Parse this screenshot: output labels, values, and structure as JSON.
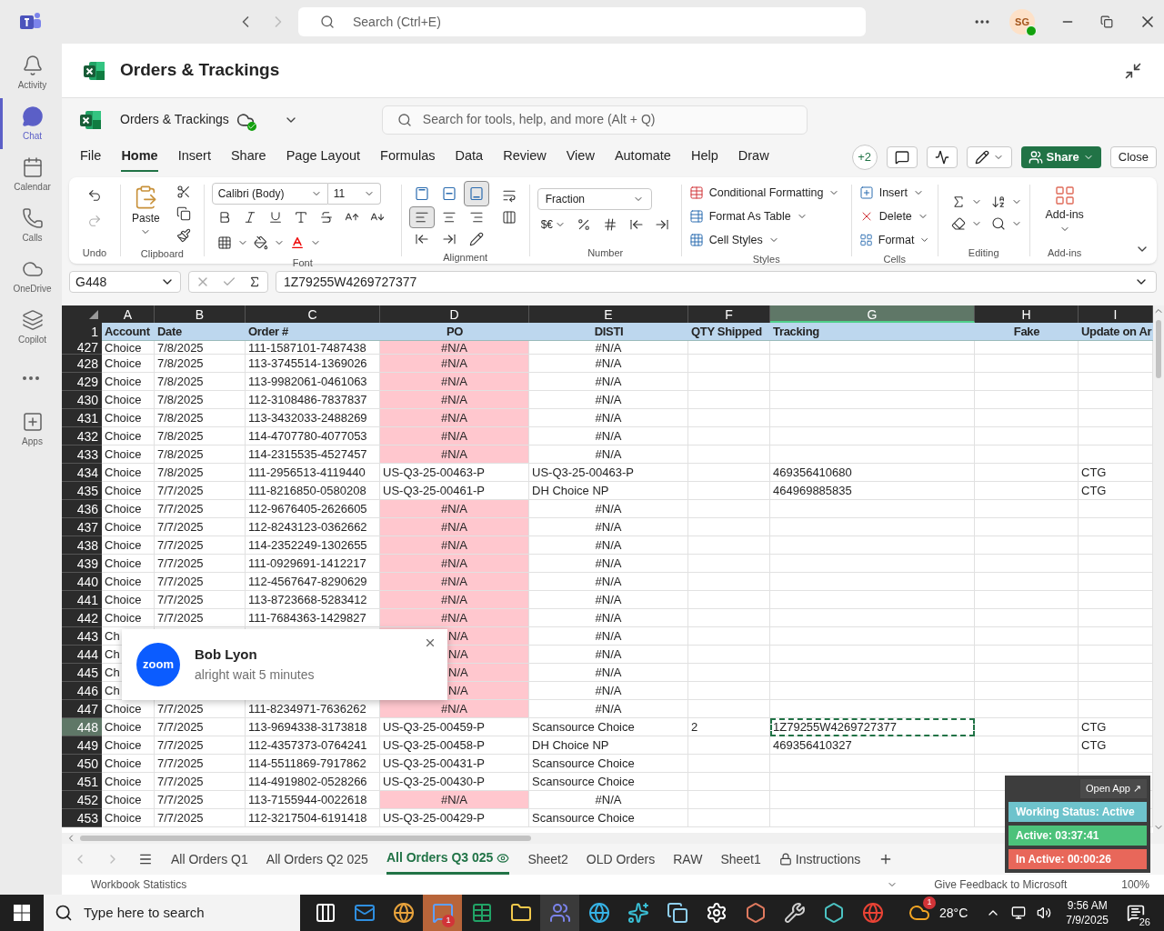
{
  "teams_bar": {
    "search_placeholder": "Search (Ctrl+E)",
    "avatar": "SG"
  },
  "rail": [
    {
      "label": "Activity",
      "selected": false
    },
    {
      "label": "Chat",
      "selected": true
    },
    {
      "label": "Calendar",
      "selected": false
    },
    {
      "label": "Calls",
      "selected": false
    },
    {
      "label": "OneDrive",
      "selected": false
    },
    {
      "label": "Copilot",
      "selected": false
    },
    {
      "label": "Apps",
      "selected": false
    }
  ],
  "app_header": {
    "title": "Orders & Trackings"
  },
  "excel_header": {
    "file_name": "Orders & Trackings",
    "search_placeholder": "Search for tools, help, and more (Alt + Q)"
  },
  "menu_tabs": [
    {
      "label": "File",
      "selected": false
    },
    {
      "label": "Home",
      "selected": true
    },
    {
      "label": "Insert",
      "selected": false
    },
    {
      "label": "Share",
      "selected": false
    },
    {
      "label": "Page Layout",
      "selected": false
    },
    {
      "label": "Formulas",
      "selected": false
    },
    {
      "label": "Data",
      "selected": false
    },
    {
      "label": "Review",
      "selected": false
    },
    {
      "label": "View",
      "selected": false
    },
    {
      "label": "Automate",
      "selected": false
    },
    {
      "label": "Help",
      "selected": false
    },
    {
      "label": "Draw",
      "selected": false
    }
  ],
  "toolbar": {
    "collaborators": "+2",
    "share": "Share",
    "close": "Close"
  },
  "ribbon": {
    "undo_group": "Undo",
    "paste": "Paste",
    "clipboard_group": "Clipboard",
    "font_name": "Calibri (Body)",
    "font_size": "11",
    "font_group": "Font",
    "vertical_align": [
      {
        "selected": false
      },
      {
        "selected": false
      },
      {
        "selected": true
      }
    ],
    "horizontal_align": [
      {
        "selected": true
      },
      {
        "selected": false
      },
      {
        "selected": false
      }
    ],
    "alignment_group": "Alignment",
    "number_format": "Fraction",
    "currency": "$€",
    "number_group": "Number",
    "styles": [
      "Conditional Formatting",
      "Format As Table",
      "Cell Styles"
    ],
    "styles_group": "Styles",
    "cells": [
      "Insert",
      "Delete",
      "Format"
    ],
    "cells_group": "Cells",
    "editing_group": "Editing",
    "addins": "Add-ins",
    "addins_group": "Add-ins"
  },
  "formula_bar": {
    "name_box": "G448",
    "formula": "1Z79255W4269727377"
  },
  "grid": {
    "columns": [
      {
        "letter": "A",
        "heading": "Account",
        "selected": false
      },
      {
        "letter": "B",
        "heading": "Date",
        "selected": false
      },
      {
        "letter": "C",
        "heading": "Order #",
        "selected": false
      },
      {
        "letter": "D",
        "heading": "PO",
        "selected": false
      },
      {
        "letter": "E",
        "heading": "DISTI",
        "selected": false
      },
      {
        "letter": "F",
        "heading": "QTY Shipped",
        "selected": false
      },
      {
        "letter": "G",
        "heading": "Tracking",
        "selected": true
      },
      {
        "letter": "H",
        "heading": "Fake",
        "selected": false
      },
      {
        "letter": "I",
        "heading": "Update on Ar",
        "selected": false
      }
    ],
    "heading_row": "1",
    "rows": [
      {
        "number": "427",
        "account": "Choice",
        "date": "7/8/2025",
        "order": "111-1587101-7487438",
        "po": "#N/A",
        "po_error": true,
        "disti": "#N/A",
        "disti_error": true,
        "selected": false
      },
      {
        "number": "428",
        "account": "Choice",
        "date": "7/8/2025",
        "order": "113-3745514-1369026",
        "po": "#N/A",
        "po_error": true,
        "disti": "#N/A",
        "disti_error": true,
        "selected": false
      },
      {
        "number": "429",
        "account": "Choice",
        "date": "7/8/2025",
        "order": "113-9982061-0461063",
        "po": "#N/A",
        "po_error": true,
        "disti": "#N/A",
        "disti_error": true,
        "selected": false
      },
      {
        "number": "430",
        "account": "Choice",
        "date": "7/8/2025",
        "order": "112-3108486-7837837",
        "po": "#N/A",
        "po_error": true,
        "disti": "#N/A",
        "disti_error": true,
        "selected": false
      },
      {
        "number": "431",
        "account": "Choice",
        "date": "7/8/2025",
        "order": "113-3432033-2488269",
        "po": "#N/A",
        "po_error": true,
        "disti": "#N/A",
        "disti_error": true,
        "selected": false
      },
      {
        "number": "432",
        "account": "Choice",
        "date": "7/8/2025",
        "order": "114-4707780-4077053",
        "po": "#N/A",
        "po_error": true,
        "disti": "#N/A",
        "disti_error": true,
        "selected": false
      },
      {
        "number": "433",
        "account": "Choice",
        "date": "7/8/2025",
        "order": "114-2315535-4527457",
        "po": "#N/A",
        "po_error": true,
        "disti": "#N/A",
        "disti_error": true,
        "selected": false
      },
      {
        "number": "434",
        "account": "Choice",
        "date": "7/8/2025",
        "order": "111-2956513-4119440",
        "po": "US-Q3-25-00463-P",
        "po_error": false,
        "disti": "US-Q3-25-00463-P",
        "disti_error": false,
        "tracking": "469356410680",
        "update": "CTG",
        "selected": false
      },
      {
        "number": "435",
        "account": "Choice",
        "date": "7/7/2025",
        "order": "111-8216850-0580208",
        "po": "US-Q3-25-00461-P",
        "po_error": false,
        "disti": "DH Choice NP",
        "disti_error": false,
        "tracking": "464969885835",
        "update": "CTG",
        "selected": false
      },
      {
        "number": "436",
        "account": "Choice",
        "date": "7/7/2025",
        "order": "112-9676405-2626605",
        "po": "#N/A",
        "po_error": true,
        "disti": "#N/A",
        "disti_error": true,
        "selected": false
      },
      {
        "number": "437",
        "account": "Choice",
        "date": "7/7/2025",
        "order": "112-8243123-0362662",
        "po": "#N/A",
        "po_error": true,
        "disti": "#N/A",
        "disti_error": true,
        "selected": false
      },
      {
        "number": "438",
        "account": "Choice",
        "date": "7/7/2025",
        "order": "114-2352249-1302655",
        "po": "#N/A",
        "po_error": true,
        "disti": "#N/A",
        "disti_error": true,
        "selected": false
      },
      {
        "number": "439",
        "account": "Choice",
        "date": "7/7/2025",
        "order": "111-0929691-1412217",
        "po": "#N/A",
        "po_error": true,
        "disti": "#N/A",
        "disti_error": true,
        "selected": false
      },
      {
        "number": "440",
        "account": "Choice",
        "date": "7/7/2025",
        "order": "112-4567647-8290629",
        "po": "#N/A",
        "po_error": true,
        "disti": "#N/A",
        "disti_error": true,
        "selected": false
      },
      {
        "number": "441",
        "account": "Choice",
        "date": "7/7/2025",
        "order": "113-8723668-5283412",
        "po": "#N/A",
        "po_error": true,
        "disti": "#N/A",
        "disti_error": true,
        "selected": false
      },
      {
        "number": "442",
        "account": "Choice",
        "date": "7/7/2025",
        "order": "111-7684363-1429827",
        "po": "#N/A",
        "po_error": true,
        "disti": "#N/A",
        "disti_error": true,
        "selected": false
      },
      {
        "number": "443",
        "kind": "covered",
        "account": "Ch",
        "po": "N/A",
        "po_error": true,
        "disti": "#N/A",
        "disti_error": true,
        "selected": false
      },
      {
        "number": "444",
        "kind": "covered",
        "account": "Ch",
        "po": "N/A",
        "po_error": true,
        "disti": "#N/A",
        "disti_error": true,
        "selected": false
      },
      {
        "number": "445",
        "kind": "covered",
        "account": "Ch",
        "po": "N/A",
        "po_error": true,
        "disti": "#N/A",
        "disti_error": true,
        "selected": false
      },
      {
        "number": "446",
        "kind": "covered",
        "account": "Ch",
        "po": "N/A",
        "po_error": true,
        "disti": "#N/A",
        "disti_error": true,
        "selected": false
      },
      {
        "number": "447",
        "account": "Choice",
        "date": "7/7/2025",
        "order": "111-8234971-7636262",
        "po": "#N/A",
        "po_error": true,
        "disti": "#N/A",
        "disti_error": true,
        "selected": false
      },
      {
        "number": "448",
        "account": "Choice",
        "date": "7/7/2025",
        "order": "113-9694338-3173818",
        "po": "US-Q3-25-00459-P",
        "po_error": false,
        "disti": "Scansource Choice",
        "disti_error": false,
        "qty": "2",
        "tracking": "1Z79255W4269727377",
        "update": "CTG",
        "selected": true
      },
      {
        "number": "449",
        "account": "Choice",
        "date": "7/7/2025",
        "order": "112-4357373-0764241",
        "po": "US-Q3-25-00458-P",
        "po_error": false,
        "disti": "DH Choice NP",
        "disti_error": false,
        "tracking": "469356410327",
        "update": "CTG",
        "selected": false
      },
      {
        "number": "450",
        "account": "Choice",
        "date": "7/7/2025",
        "order": "114-5511869-7917862",
        "po": "US-Q3-25-00431-P",
        "po_error": false,
        "disti": "Scansource Choice",
        "disti_error": false,
        "selected": false
      },
      {
        "number": "451",
        "account": "Choice",
        "date": "7/7/2025",
        "order": "114-4919802-0528266",
        "po": "US-Q3-25-00430-P",
        "po_error": false,
        "disti": "Scansource Choice",
        "disti_error": false,
        "selected": false
      },
      {
        "number": "452",
        "account": "Choice",
        "date": "7/7/2025",
        "order": "113-7155944-0022618",
        "po": "#N/A",
        "po_error": true,
        "disti": "#N/A",
        "disti_error": true,
        "selected": false
      },
      {
        "number": "453",
        "account": "Choice",
        "date": "7/7/2025",
        "order": "112-3217504-6191418",
        "po": "US-Q3-25-00429-P",
        "po_error": false,
        "disti": "Scansource Choice",
        "disti_error": false,
        "selected": false
      }
    ]
  },
  "toast": {
    "logo": "zoom",
    "sender": "Bob Lyon",
    "message": "alright wait 5 minutes"
  },
  "sheet_tabs": [
    {
      "label": "All Orders Q1",
      "selected": false,
      "kind": "plain"
    },
    {
      "label": "All Orders Q2 025",
      "selected": false,
      "kind": "plain"
    },
    {
      "label": "All Orders Q3 025",
      "selected": true,
      "kind": "watched"
    },
    {
      "label": "Sheet2",
      "selected": false,
      "kind": "plain"
    },
    {
      "label": "OLD Orders",
      "selected": false,
      "kind": "plain"
    },
    {
      "label": "RAW",
      "selected": false,
      "kind": "plain"
    },
    {
      "label": "Sheet1",
      "selected": false,
      "kind": "plain"
    },
    {
      "label": "Instructions",
      "selected": false,
      "kind": "locked"
    }
  ],
  "status_bar": {
    "statistics": "Workbook Statistics",
    "feedback": "Give Feedback to Microsoft",
    "zoom": "100%"
  },
  "tracker": {
    "open_app": "Open App ↗",
    "rows": [
      {
        "label": "Working Status: Active",
        "color": "#6ec3cc"
      },
      {
        "label": "Active: 03:37:41",
        "color": "#4cc27a"
      },
      {
        "label": "In Active: 00:00:26",
        "color": "#e8675a"
      }
    ]
  },
  "taskbar": {
    "search_placeholder": "Type here to search",
    "apps": [
      {
        "flashing": false,
        "focused": false
      },
      {
        "flashing": false,
        "focused": false
      },
      {
        "flashing": false,
        "focused": false
      },
      {
        "flashing": true,
        "focused": false,
        "badge": "1"
      },
      {
        "flashing": false,
        "focused": false
      },
      {
        "flashing": false,
        "focused": false
      },
      {
        "flashing": false,
        "focused": true
      },
      {
        "flashing": false,
        "focused": false
      },
      {
        "flashing": false,
        "focused": false
      },
      {
        "flashing": false,
        "focused": false
      },
      {
        "flashing": false,
        "focused": false
      },
      {
        "flashing": false,
        "focused": false
      },
      {
        "flashing": false,
        "focused": false
      },
      {
        "flashing": false,
        "focused": false
      },
      {
        "flashing": false,
        "focused": false
      }
    ],
    "weather_badge": "1",
    "temperature": "28°C",
    "time": "9:56 AM",
    "date": "7/9/2025",
    "notifications": "26"
  }
}
